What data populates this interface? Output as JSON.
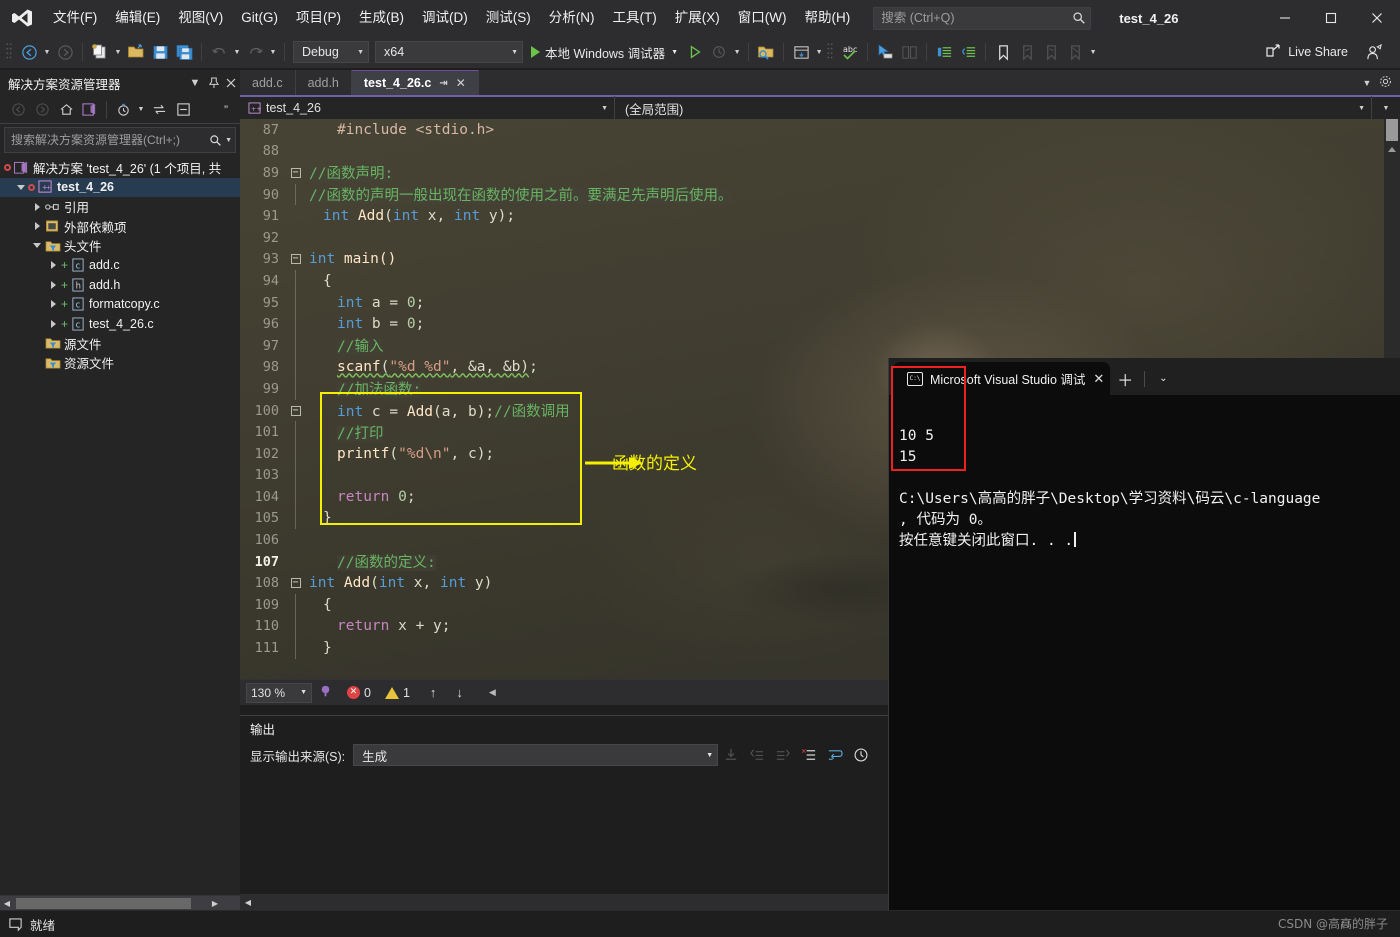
{
  "titlebar": {
    "logo_icon": "visual-studio-logo",
    "menus": [
      {
        "label": "文件(F)"
      },
      {
        "label": "编辑(E)"
      },
      {
        "label": "视图(V)"
      },
      {
        "label": "Git(G)"
      },
      {
        "label": "项目(P)"
      },
      {
        "label": "生成(B)"
      },
      {
        "label": "调试(D)"
      },
      {
        "label": "测试(S)"
      },
      {
        "label": "分析(N)"
      },
      {
        "label": "工具(T)"
      },
      {
        "label": "扩展(X)"
      },
      {
        "label": "窗口(W)"
      },
      {
        "label": "帮助(H)"
      }
    ],
    "search_placeholder": "搜索 (Ctrl+Q)",
    "search_value": "",
    "window_title": "test_4_26",
    "minimize": "—",
    "maximize": "□",
    "close": "✕"
  },
  "toolbar": {
    "back_icon": "navigate-back-icon",
    "forward_icon": "navigate-forward-icon",
    "new_item_icon": "new-item-icon",
    "open_icon": "open-file-icon",
    "save_icon": "save-icon",
    "save_all_icon": "save-all-icon",
    "undo_icon": "undo-icon",
    "redo_icon": "redo-icon",
    "config_value": "Debug",
    "platform_value": "x64",
    "run_label": "本地 Windows 调试器",
    "run_icon": "play-icon",
    "start_no_debug_icon": "play-outline-icon",
    "solution_search_icon": "folder-search-icon",
    "window_layout_icon": "window-layout-icon",
    "spell_icon": "spell-check-icon",
    "pointer_icon": "select-tool-icon",
    "compare_icon": "compare-icon",
    "indent_icon": "indent-icon",
    "outdent_icon": "outdent-icon",
    "bookmark_icon": "bookmark-icon",
    "bookmark_prev_icon": "bookmark-prev-icon",
    "bookmark_next_icon": "bookmark-next-icon",
    "bookmark_clear_icon": "bookmark-clear-icon",
    "live_share_label": "Live Share",
    "live_share_icon": "live-share-icon",
    "feedback_icon": "feedback-icon"
  },
  "solution_explorer": {
    "title": "解决方案资源管理器",
    "filter_icon": "chevron-down-icon",
    "pin_icon": "pin-icon",
    "close_icon": "close-icon",
    "toolbar_icons": [
      "back-icon",
      "forward-icon",
      "home-icon",
      "solution-view-icon",
      "pending-changes-icon",
      "sync-icon",
      "collapse-all-icon",
      "overflow-icon"
    ],
    "search_placeholder": "搜索解决方案资源管理器(Ctrl+;)",
    "search_value": "",
    "search_icon": "search-icon",
    "search_dropdown_icon": "chevron-down-icon",
    "tree": [
      {
        "label": "解决方案 'test_4_26' (1 个项目, 共",
        "indent": 0,
        "icon": "solution-icon",
        "expander": "none",
        "bold": false,
        "status": "modified"
      },
      {
        "label": "test_4_26",
        "indent": 1,
        "icon": "cpp-project-icon",
        "expander": "expanded",
        "bold": true,
        "status": "modified"
      },
      {
        "label": "引用",
        "indent": 2,
        "icon": "references-icon",
        "expander": "collapsed",
        "bold": false
      },
      {
        "label": "外部依赖项",
        "indent": 2,
        "icon": "external-deps-icon",
        "expander": "collapsed",
        "bold": false
      },
      {
        "label": "头文件",
        "indent": 2,
        "icon": "filter-folder-icon",
        "expander": "expanded",
        "bold": false
      },
      {
        "label": "add.c",
        "indent": 3,
        "icon": "c-file-icon",
        "expander": "collapsed",
        "bold": false,
        "added": true
      },
      {
        "label": "add.h",
        "indent": 3,
        "icon": "h-file-icon",
        "expander": "collapsed",
        "bold": false,
        "added": true
      },
      {
        "label": "formatcopy.c",
        "indent": 3,
        "icon": "c-file-icon",
        "expander": "collapsed",
        "bold": false,
        "added": true
      },
      {
        "label": "test_4_26.c",
        "indent": 3,
        "icon": "c-file-icon",
        "expander": "collapsed",
        "bold": false,
        "added": true
      },
      {
        "label": "源文件",
        "indent": 2,
        "icon": "filter-folder-icon",
        "expander": "none",
        "bold": false
      },
      {
        "label": "资源文件",
        "indent": 2,
        "icon": "filter-folder-icon",
        "expander": "none",
        "bold": false
      }
    ]
  },
  "editor": {
    "tabs": [
      {
        "label": "add.c",
        "active": false
      },
      {
        "label": "add.h",
        "active": false
      },
      {
        "label": "test_4_26.c",
        "active": true
      }
    ],
    "tab_pin_icon": "pin-icon",
    "tab_close_icon": "close-icon",
    "nav_project": "test_4_26",
    "nav_scope": "(全局范围)",
    "nav_project_icon": "cpp-project-icon",
    "lines": [
      {
        "num": "87",
        "fold": "none",
        "bar": false,
        "tokens": [
          {
            "t": "#include <stdio.h>",
            "c": "mac",
            "hl": true
          }
        ],
        "indent": 2
      },
      {
        "num": "88",
        "fold": "none",
        "bar": false,
        "tokens": [],
        "indent": 0
      },
      {
        "num": "89",
        "fold": "minus",
        "bar": false,
        "tokens": [
          {
            "t": "//函数声明:",
            "c": "cmt",
            "hl": true
          }
        ],
        "indent": 0
      },
      {
        "num": "90",
        "fold": "none",
        "bar": true,
        "tokens": [
          {
            "t": "//函数的声明一般出现在函数的使用之前。要满足先声明后使用。",
            "c": "cmt",
            "hl": true
          }
        ],
        "indent": 0
      },
      {
        "num": "91",
        "fold": "none",
        "bar": false,
        "tokens": [
          {
            "t": "int ",
            "c": "kw"
          },
          {
            "t": "Add",
            "c": "fn"
          },
          {
            "t": "(",
            "c": "pln"
          },
          {
            "t": "int ",
            "c": "kw"
          },
          {
            "t": "x, ",
            "c": "pln"
          },
          {
            "t": "int ",
            "c": "kw"
          },
          {
            "t": "y);",
            "c": "pln"
          }
        ],
        "indent": 1
      },
      {
        "num": "92",
        "fold": "none",
        "bar": false,
        "tokens": [],
        "indent": 0
      },
      {
        "num": "93",
        "fold": "minus",
        "bar": false,
        "tokens": [
          {
            "t": "int ",
            "c": "kw"
          },
          {
            "t": "main()",
            "c": "fn"
          }
        ],
        "indent": 0
      },
      {
        "num": "94",
        "fold": "none",
        "bar": true,
        "tokens": [
          {
            "t": "{",
            "c": "pln"
          }
        ],
        "indent": 1
      },
      {
        "num": "95",
        "fold": "none",
        "bar": true,
        "tokens": [
          {
            "t": "int ",
            "c": "kw"
          },
          {
            "t": "a = ",
            "c": "pln"
          },
          {
            "t": "0",
            "c": "num"
          },
          {
            "t": ";",
            "c": "pln"
          }
        ],
        "indent": 2
      },
      {
        "num": "96",
        "fold": "none",
        "bar": true,
        "tokens": [
          {
            "t": "int ",
            "c": "kw"
          },
          {
            "t": "b = ",
            "c": "pln"
          },
          {
            "t": "0",
            "c": "num"
          },
          {
            "t": ";",
            "c": "pln"
          }
        ],
        "indent": 2
      },
      {
        "num": "97",
        "fold": "none",
        "bar": true,
        "tokens": [
          {
            "t": "//输入",
            "c": "cmt",
            "hl": true
          }
        ],
        "indent": 2
      },
      {
        "num": "98",
        "fold": "none",
        "bar": true,
        "tokens": [
          {
            "t": "scanf",
            "c": "fn",
            "squig": true
          },
          {
            "t": "(",
            "c": "pln",
            "squig": true
          },
          {
            "t": "\"%d %d\"",
            "c": "str",
            "squig": true
          },
          {
            "t": ", &a, &b)",
            "c": "pln",
            "squig": true
          },
          {
            "t": ";",
            "c": "pln"
          }
        ],
        "indent": 2
      },
      {
        "num": "99",
        "fold": "none",
        "bar": true,
        "tokens": [
          {
            "t": "//加法函数:",
            "c": "cmt",
            "hl": true
          }
        ],
        "indent": 2
      },
      {
        "num": "100",
        "fold": "minus",
        "bar": false,
        "tokens": [
          {
            "t": "int ",
            "c": "kw"
          },
          {
            "t": "c = ",
            "c": "pln"
          },
          {
            "t": "Add",
            "c": "fn"
          },
          {
            "t": "(a, b);",
            "c": "pln"
          },
          {
            "t": "//函数调用",
            "c": "cmt"
          }
        ],
        "indent": 2
      },
      {
        "num": "101",
        "fold": "none",
        "bar": true,
        "tokens": [
          {
            "t": "//打印",
            "c": "cmt",
            "hl": true
          }
        ],
        "indent": 2
      },
      {
        "num": "102",
        "fold": "none",
        "bar": true,
        "tokens": [
          {
            "t": "printf",
            "c": "fn"
          },
          {
            "t": "(",
            "c": "pln"
          },
          {
            "t": "\"%d\\n\"",
            "c": "str"
          },
          {
            "t": ", c);",
            "c": "pln"
          }
        ],
        "indent": 2
      },
      {
        "num": "103",
        "fold": "none",
        "bar": true,
        "tokens": [],
        "indent": 0
      },
      {
        "num": "104",
        "fold": "none",
        "bar": true,
        "tokens": [
          {
            "t": "return ",
            "c": "ret"
          },
          {
            "t": "0",
            "c": "num"
          },
          {
            "t": ";",
            "c": "pln"
          }
        ],
        "indent": 2
      },
      {
        "num": "105",
        "fold": "none",
        "bar": true,
        "tokens": [
          {
            "t": "}",
            "c": "pln"
          }
        ],
        "indent": 1
      },
      {
        "num": "106",
        "fold": "none",
        "bar": false,
        "tokens": [],
        "indent": 0
      },
      {
        "num": "107",
        "fold": "none",
        "bar": false,
        "current": true,
        "tokens": [
          {
            "t": "//函数的定义:",
            "c": "cmt",
            "hl": true
          }
        ],
        "indent": 2
      },
      {
        "num": "108",
        "fold": "minus",
        "bar": false,
        "tokens": [
          {
            "t": "int ",
            "c": "kw"
          },
          {
            "t": "Add",
            "c": "fn"
          },
          {
            "t": "(",
            "c": "pln"
          },
          {
            "t": "int ",
            "c": "kw"
          },
          {
            "t": "x, ",
            "c": "pln"
          },
          {
            "t": "int ",
            "c": "kw"
          },
          {
            "t": "y)",
            "c": "pln"
          }
        ],
        "indent": 0
      },
      {
        "num": "109",
        "fold": "none",
        "bar": true,
        "tokens": [
          {
            "t": "{",
            "c": "pln"
          }
        ],
        "indent": 1
      },
      {
        "num": "110",
        "fold": "none",
        "bar": true,
        "tokens": [
          {
            "t": "return ",
            "c": "ret"
          },
          {
            "t": "x + y;",
            "c": "pln"
          }
        ],
        "indent": 2
      },
      {
        "num": "111",
        "fold": "none",
        "bar": true,
        "tokens": [
          {
            "t": "}",
            "c": "pln"
          }
        ],
        "indent": 1
      }
    ],
    "annotation_label": "函数的定义",
    "annotation_color": "#f5f000",
    "footer": {
      "zoom": "130 %",
      "zoom_dropdown_icon": "chevron-down-icon",
      "intellisense_icon": "intellisense-icon",
      "error_count": "0",
      "warning_count": "1",
      "error_icon": "error-icon",
      "warning_icon": "warning-icon",
      "prev_icon": "arrow-up-icon",
      "next_icon": "arrow-down-icon",
      "expand_icon": "arrow-left-icon"
    }
  },
  "output": {
    "title": "输出",
    "source_label": "显示输出来源(S):",
    "source_value": "生成",
    "source_dropdown_icon": "chevron-down-icon",
    "toolbar_icons": [
      "goto-message-icon",
      "prev-message-icon",
      "next-message-icon",
      "clear-all-icon",
      "word-wrap-icon",
      "toggle-timestamp-icon"
    ],
    "content": ""
  },
  "console": {
    "tab_title": "Microsoft Visual Studio 调试",
    "tab_icon": "cmd-icon",
    "close_icon": "close-icon",
    "new_tab_icon": "plus-icon",
    "dropdown_icon": "chevron-down-icon",
    "output_lines": [
      "10 5",
      "15",
      "",
      "C:\\Users\\高高的胖子\\Desktop\\学习资料\\码云\\c-language",
      ", 代码为 0。",
      "按任意键关闭此窗口. . ."
    ],
    "highlight_color": "#ef2020"
  },
  "statusbar": {
    "ready_text": "就绪",
    "ready_icon": "ready-icon",
    "sync_icon": "updown-arrows-icon",
    "watermark": "CSDN @高高的胖子"
  }
}
